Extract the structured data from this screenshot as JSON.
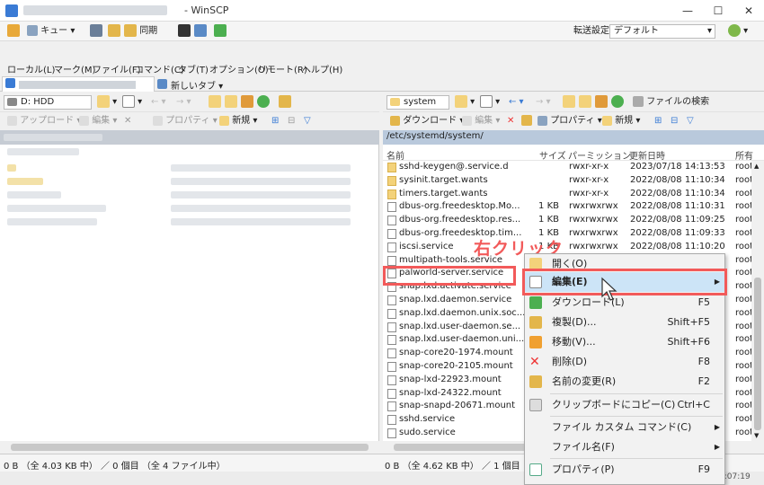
{
  "window": {
    "title": "- WinSCP",
    "controls": [
      "—",
      "☐",
      "✕"
    ]
  },
  "toolbar": {
    "queue_label": "キュー",
    "sync_label": "同期",
    "transfer_settings_label": "転送設定",
    "transfer_settings_value": "デフォルト"
  },
  "menu": [
    "ローカル(L)",
    "マーク(M)",
    "ファイル(F)",
    "コマンド(C)",
    "タブ(T)",
    "オプション(O)",
    "リモート(R)",
    "ヘルプ(H)"
  ],
  "tabs": {
    "new_tab": "新しいタブ"
  },
  "left_pane": {
    "drive": "D: HDD",
    "upload": "アップロード",
    "edit": "編集",
    "properties": "プロパティ",
    "new": "新規",
    "status": "0 B （全 4.03 KB 中） ／ 0 個目 （全 4 ファイル中）"
  },
  "right_pane": {
    "folder": "system",
    "find_files": "ファイルの検索",
    "download": "ダウンロード",
    "edit": "編集",
    "properties": "プロパティ",
    "new": "新規",
    "path": "/etc/systemd/system/",
    "columns": {
      "name": "名前",
      "size": "サイズ",
      "perm": "パーミッション",
      "date": "更新日時",
      "owner": "所有"
    },
    "status": "0 B （全 4.62 KB 中） ／ 1 個目 （全 4",
    "rows": [
      {
        "name": "sshd-keygen@.service.d",
        "size": "",
        "perm": "rwxr-xr-x",
        "date": "2023/07/18 14:13:53",
        "owner": "root",
        "type": "folder"
      },
      {
        "name": "sysinit.target.wants",
        "size": "",
        "perm": "rwxr-xr-x",
        "date": "2022/08/08 11:10:34",
        "owner": "root",
        "type": "folder"
      },
      {
        "name": "timers.target.wants",
        "size": "",
        "perm": "rwxr-xr-x",
        "date": "2022/08/08 11:10:34",
        "owner": "root",
        "type": "folder"
      },
      {
        "name": "dbus-org.freedesktop.Mo...",
        "size": "1 KB",
        "perm": "rwxrwxrwx",
        "date": "2022/08/08 11:10:31",
        "owner": "root",
        "type": "link"
      },
      {
        "name": "dbus-org.freedesktop.res...",
        "size": "1 KB",
        "perm": "rwxrwxrwx",
        "date": "2022/08/08 11:09:25",
        "owner": "root",
        "type": "link"
      },
      {
        "name": "dbus-org.freedesktop.tim...",
        "size": "1 KB",
        "perm": "rwxrwxrwx",
        "date": "2022/08/08 11:09:33",
        "owner": "root",
        "type": "link"
      },
      {
        "name": "iscsi.service",
        "size": "1 KB",
        "perm": "rwxrwxrwx",
        "date": "2022/08/08 11:10:20",
        "owner": "root",
        "type": "link"
      },
      {
        "name": "multipath-tools.service",
        "size": "",
        "perm": "",
        "date": "",
        "owner": "root",
        "type": "link"
      },
      {
        "name": "palworld-server.service",
        "size": "",
        "perm": "",
        "date": "",
        "owner": "root",
        "type": "file"
      },
      {
        "name": "snap.lxd.activate.service",
        "size": "",
        "perm": "",
        "date": "",
        "owner": "root",
        "type": "link"
      },
      {
        "name": "snap.lxd.daemon.service",
        "size": "",
        "perm": "",
        "date": "",
        "owner": "root",
        "type": "file"
      },
      {
        "name": "snap.lxd.daemon.unix.soc...",
        "size": "",
        "perm": "",
        "date": "",
        "owner": "root",
        "type": "file"
      },
      {
        "name": "snap.lxd.user-daemon.se...",
        "size": "",
        "perm": "",
        "date": "",
        "owner": "root",
        "type": "file"
      },
      {
        "name": "snap.lxd.user-daemon.uni...",
        "size": "",
        "perm": "",
        "date": "",
        "owner": "root",
        "type": "file"
      },
      {
        "name": "snap-core20-1974.mount",
        "size": "",
        "perm": "",
        "date": "",
        "owner": "root",
        "type": "file"
      },
      {
        "name": "snap-core20-2105.mount",
        "size": "",
        "perm": "",
        "date": "",
        "owner": "root",
        "type": "file"
      },
      {
        "name": "snap-lxd-22923.mount",
        "size": "",
        "perm": "",
        "date": "",
        "owner": "root",
        "type": "file"
      },
      {
        "name": "snap-lxd-24322.mount",
        "size": "",
        "perm": "",
        "date": "",
        "owner": "root",
        "type": "file"
      },
      {
        "name": "snap-snapd-20671.mount",
        "size": "",
        "perm": "",
        "date": "",
        "owner": "root",
        "type": "file"
      },
      {
        "name": "sshd.service",
        "size": "",
        "perm": "",
        "date": "",
        "owner": "root",
        "type": "link"
      },
      {
        "name": "sudo.service",
        "size": "",
        "perm": "",
        "date": "",
        "owner": "root",
        "type": "link"
      }
    ]
  },
  "context_menu": {
    "items": [
      {
        "label": "開く(O)",
        "shortcut": "",
        "submenu": false
      },
      {
        "label": "編集(E)",
        "shortcut": "",
        "submenu": true,
        "bold": true
      },
      {
        "label": "ダウンロード(L)",
        "shortcut": "F5",
        "submenu": false
      },
      {
        "label": "複製(D)...",
        "shortcut": "Shift+F5",
        "submenu": false
      },
      {
        "label": "移動(V)...",
        "shortcut": "Shift+F6",
        "submenu": false
      },
      {
        "label": "削除(D)",
        "shortcut": "F8",
        "submenu": false
      },
      {
        "label": "名前の変更(R)",
        "shortcut": "F2",
        "submenu": false
      },
      {
        "label": "クリップボードにコピー(C)",
        "shortcut": "Ctrl+C",
        "submenu": false
      },
      {
        "label": "ファイル カスタム コマンド(C)",
        "shortcut": "",
        "submenu": true
      },
      {
        "label": "ファイル名(F)",
        "shortcut": "",
        "submenu": true
      },
      {
        "label": "プロパティ(P)",
        "shortcut": "F9",
        "submenu": false
      }
    ]
  },
  "annotation": {
    "text": "右クリック",
    "color": "#f25a5a"
  },
  "bottom": {
    "time": "0:07:19"
  }
}
